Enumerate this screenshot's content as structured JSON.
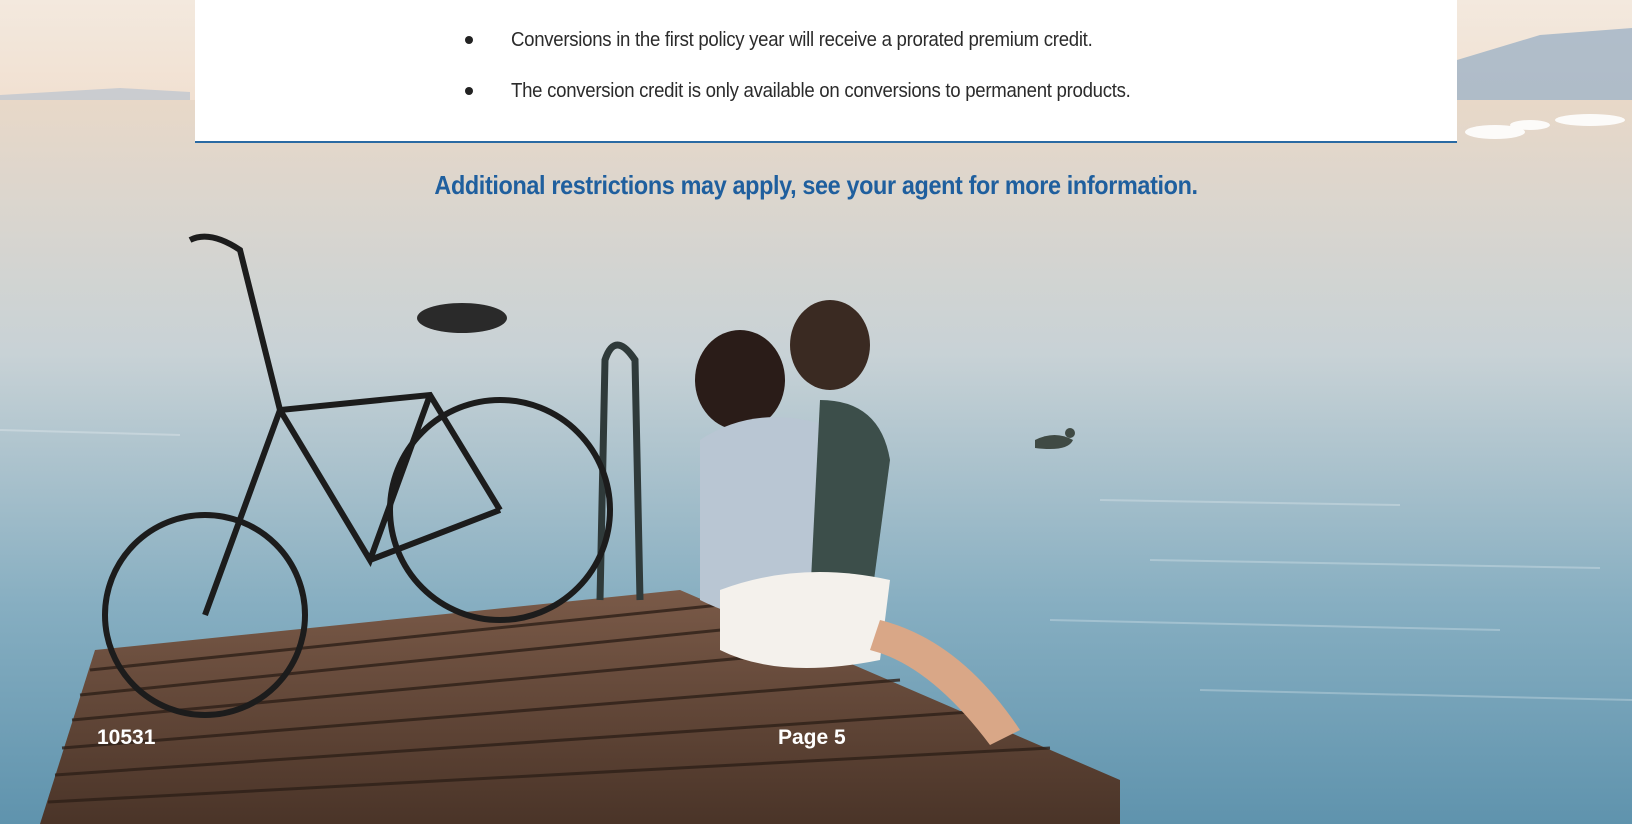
{
  "card": {
    "bullets": [
      "Conversions in the first policy year will receive a prorated premium credit.",
      "The conversion credit is only available on conversions to permanent products."
    ]
  },
  "notice": "Additional restrictions may apply, see your agent for more information.",
  "footer": {
    "code": "10531",
    "page": "Page 5"
  },
  "colors": {
    "accent": "#1f5f9e",
    "rule": "#2a6aa3"
  },
  "photo": {
    "description_icon": "lake-dock-couple-bicycle-photo"
  }
}
